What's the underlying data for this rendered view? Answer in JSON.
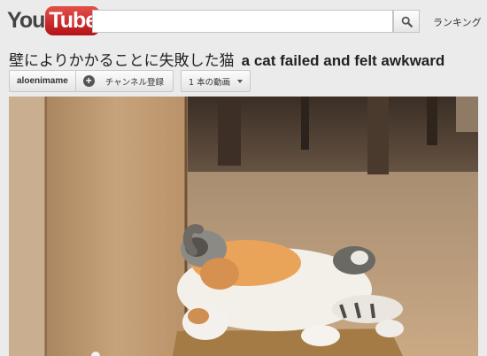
{
  "logo": {
    "you": "You",
    "tube": "Tube"
  },
  "search": {
    "value": "",
    "placeholder": ""
  },
  "nav": {
    "ranking_label": "ランキング"
  },
  "video": {
    "title_ja": "壁によりかかることに失敗した猫",
    "title_en": "a cat failed and felt awkward"
  },
  "channel": {
    "name": "aloenimame",
    "subscribe_label": "チャンネル登録",
    "videos_label": "1 本の動画"
  },
  "colors": {
    "brand_red": "#cc181e",
    "background": "#ebebeb"
  },
  "icons": {
    "search": "magnifier-icon",
    "subscribe": "plus-circle-icon",
    "dropdown": "caret-down-icon"
  }
}
